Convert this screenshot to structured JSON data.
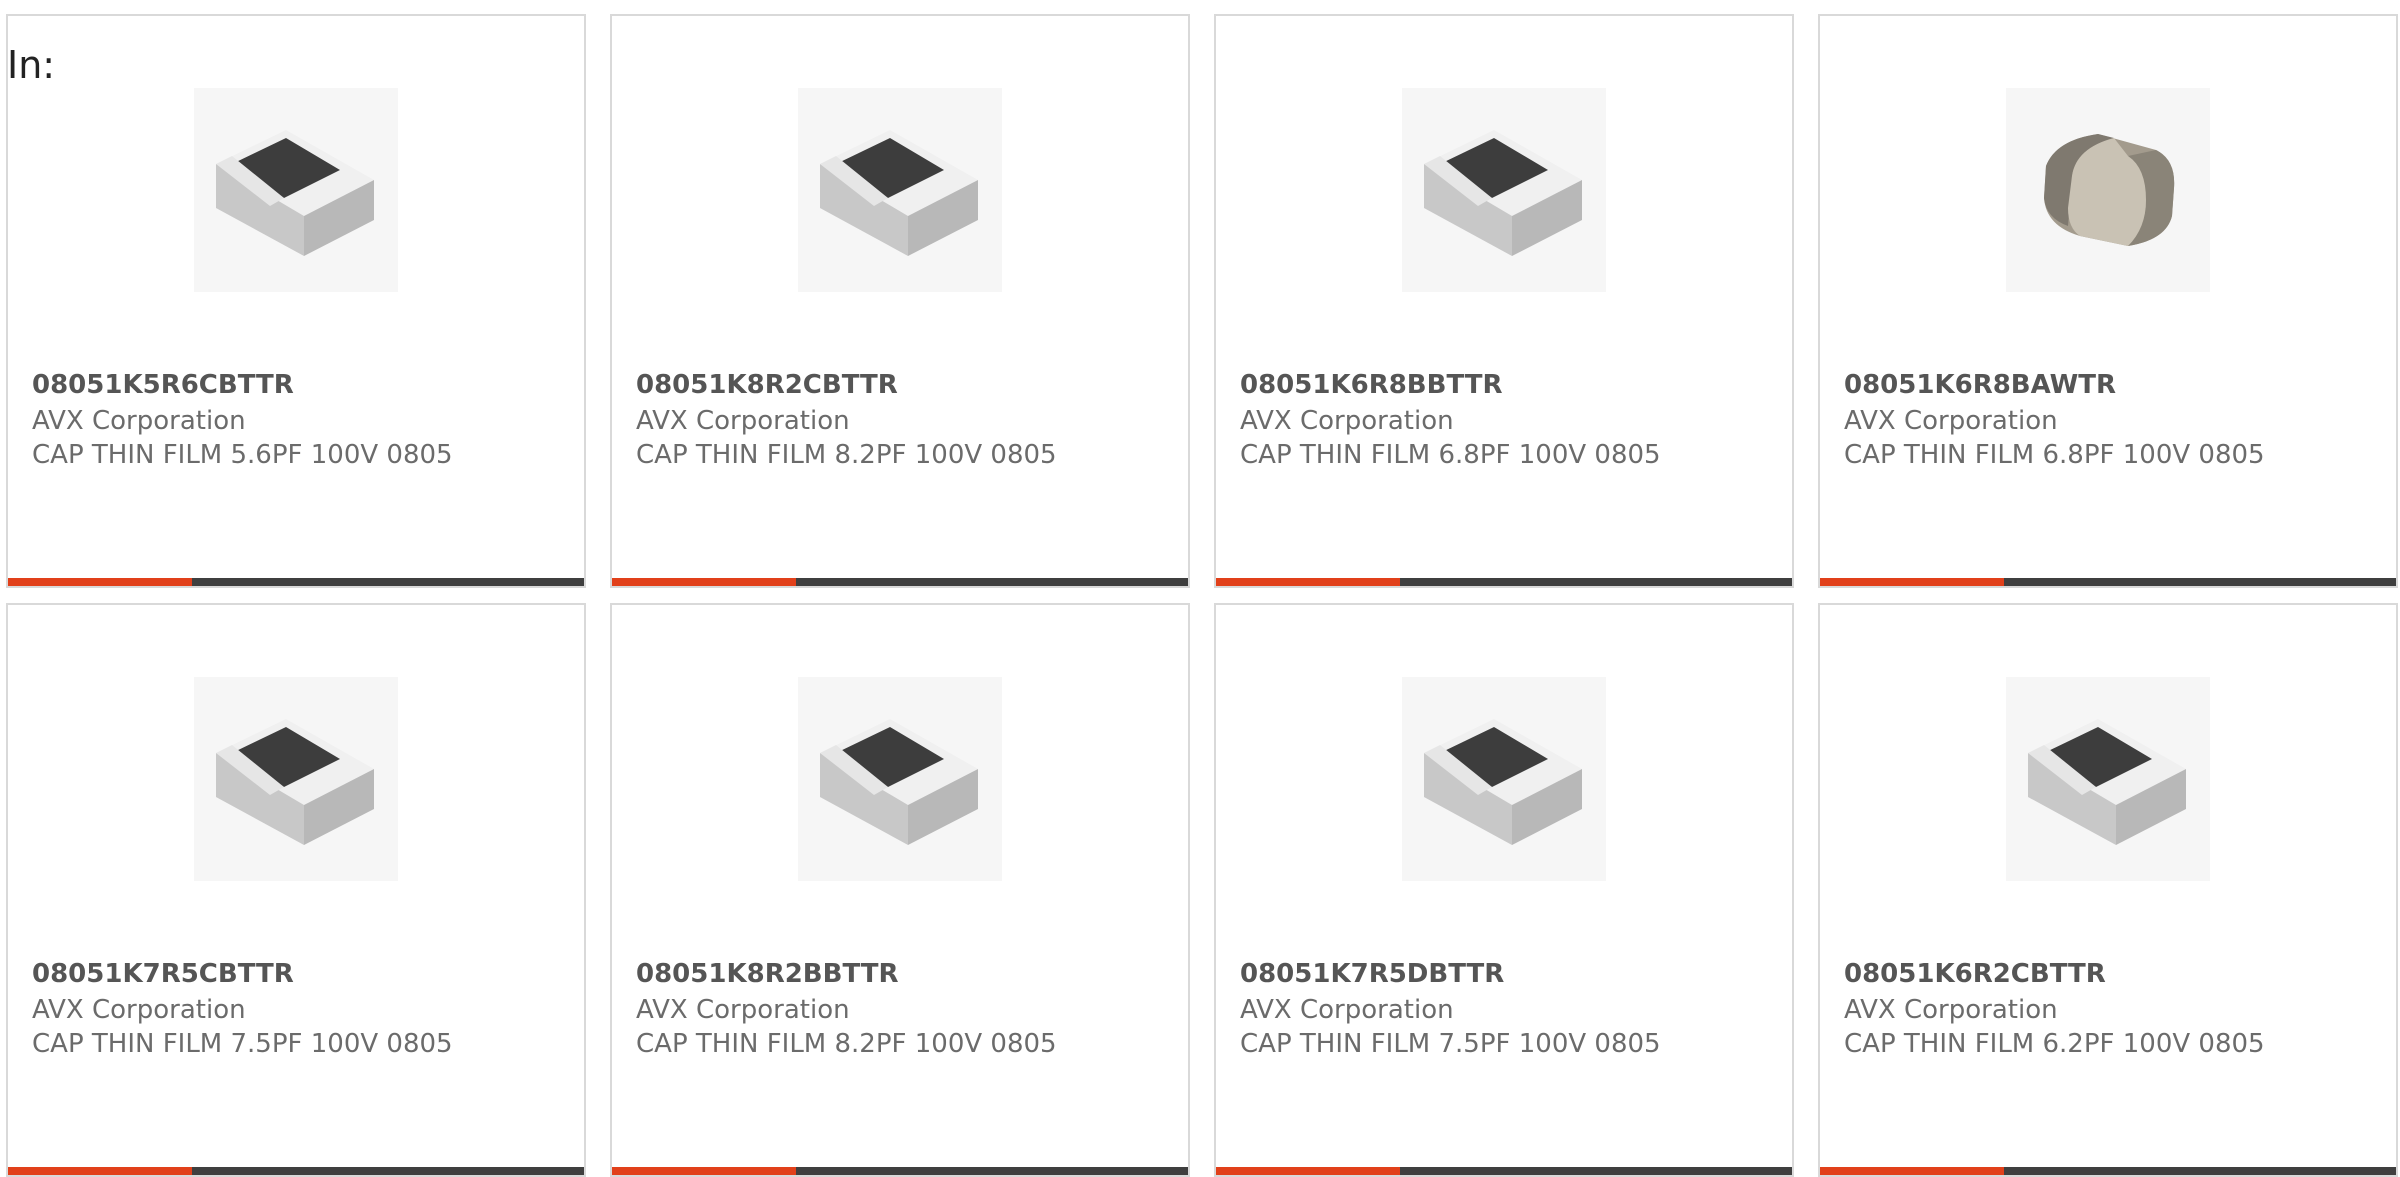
{
  "search": {
    "prefix_label": "In:"
  },
  "accent_colors": {
    "bar_accent": "#e1401a",
    "bar_base": "#3f3f3f"
  },
  "products": [
    {
      "part": "08051K5R6CBTTR",
      "maker": "AVX Corporation",
      "desc": "CAP THIN FILM 5.6PF 100V 0805",
      "image": "chip-resistor-icon",
      "progress": 0.32
    },
    {
      "part": "08051K8R2CBTTR",
      "maker": "AVX Corporation",
      "desc": "CAP THIN FILM 8.2PF 100V 0805",
      "image": "chip-resistor-icon",
      "progress": 0.32
    },
    {
      "part": "08051K6R8BBTTR",
      "maker": "AVX Corporation",
      "desc": "CAP THIN FILM 6.8PF 100V 0805",
      "image": "chip-resistor-icon",
      "progress": 0.32
    },
    {
      "part": "08051K6R8BAWTR",
      "maker": "AVX Corporation",
      "desc": "CAP THIN FILM 6.8PF 100V 0805",
      "image": "ceramic-capacitor-icon",
      "progress": 0.32
    },
    {
      "part": "08051K7R5CBTTR",
      "maker": "AVX Corporation",
      "desc": "CAP THIN FILM 7.5PF 100V 0805",
      "image": "chip-resistor-icon",
      "progress": 0.32
    },
    {
      "part": "08051K8R2BBTTR",
      "maker": "AVX Corporation",
      "desc": "CAP THIN FILM 8.2PF 100V 0805",
      "image": "chip-resistor-icon",
      "progress": 0.32
    },
    {
      "part": "08051K7R5DBTTR",
      "maker": "AVX Corporation",
      "desc": "CAP THIN FILM 7.5PF 100V 0805",
      "image": "chip-resistor-icon",
      "progress": 0.32
    },
    {
      "part": "08051K6R2CBTTR",
      "maker": "AVX Corporation",
      "desc": "CAP THIN FILM 6.2PF 100V 0805",
      "image": "chip-resistor-icon",
      "progress": 0.32
    }
  ]
}
